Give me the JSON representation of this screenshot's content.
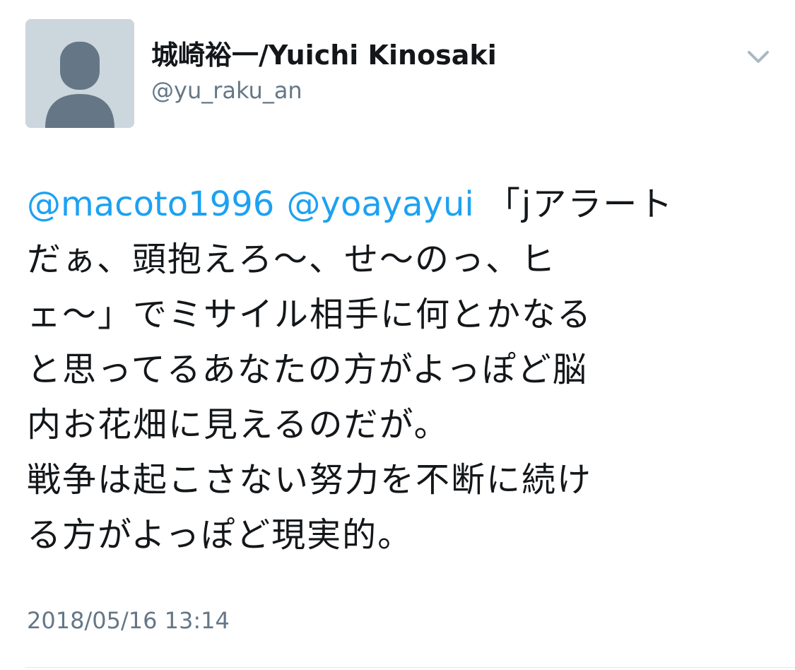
{
  "user": {
    "avatar_icon": "default-profile-icon",
    "display_name": "城崎裕一/Yuichi Kinosaki",
    "handle": "@yu_raku_an"
  },
  "menu": {
    "icon": "chevron-down-icon"
  },
  "tweet": {
    "mentions": [
      "@macoto1996",
      "@yoayayui"
    ],
    "lines": [
      "「jアラート",
      "だぁ、頭抱えろ〜、せ〜のっ、ヒ",
      "ェ〜」でミサイル相手に何とかなる",
      "と思ってるあなたの方がよっぽど脳",
      "内お花畑に見えるのだが。",
      "戦争は起こさない努力を不断に続け",
      "る方がよっぽど現実的。"
    ],
    "timestamp": "2018/05/16 13:14"
  },
  "colors": {
    "link": "#1da1f2",
    "secondary_text": "#657786",
    "primary_text": "#14171a",
    "avatar_bg": "#ccd6dd",
    "avatar_figure": "#657786"
  }
}
